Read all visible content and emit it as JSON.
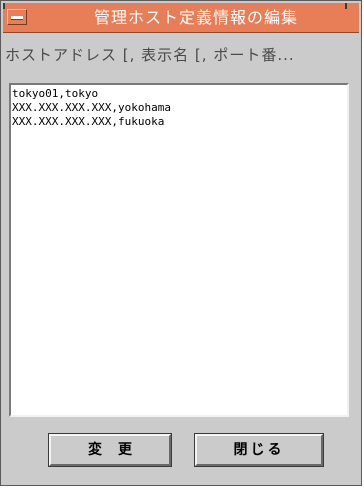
{
  "window": {
    "title": "管理ホスト定義情報の編集"
  },
  "header": {
    "column_label": "ホストアドレス [, 表示名 [, ポート番..."
  },
  "list": {
    "items": [
      "tokyo01,tokyo",
      "XXX.XXX.XXX.XXX,yokohama",
      "XXX.XXX.XXX.XXX,fukuoka"
    ]
  },
  "buttons": {
    "change_label": "変更",
    "close_label": "閉じる"
  },
  "colors": {
    "titlebar": "#e87e58",
    "window_bg": "#cbcbcb",
    "list_bg": "#ffffff"
  }
}
